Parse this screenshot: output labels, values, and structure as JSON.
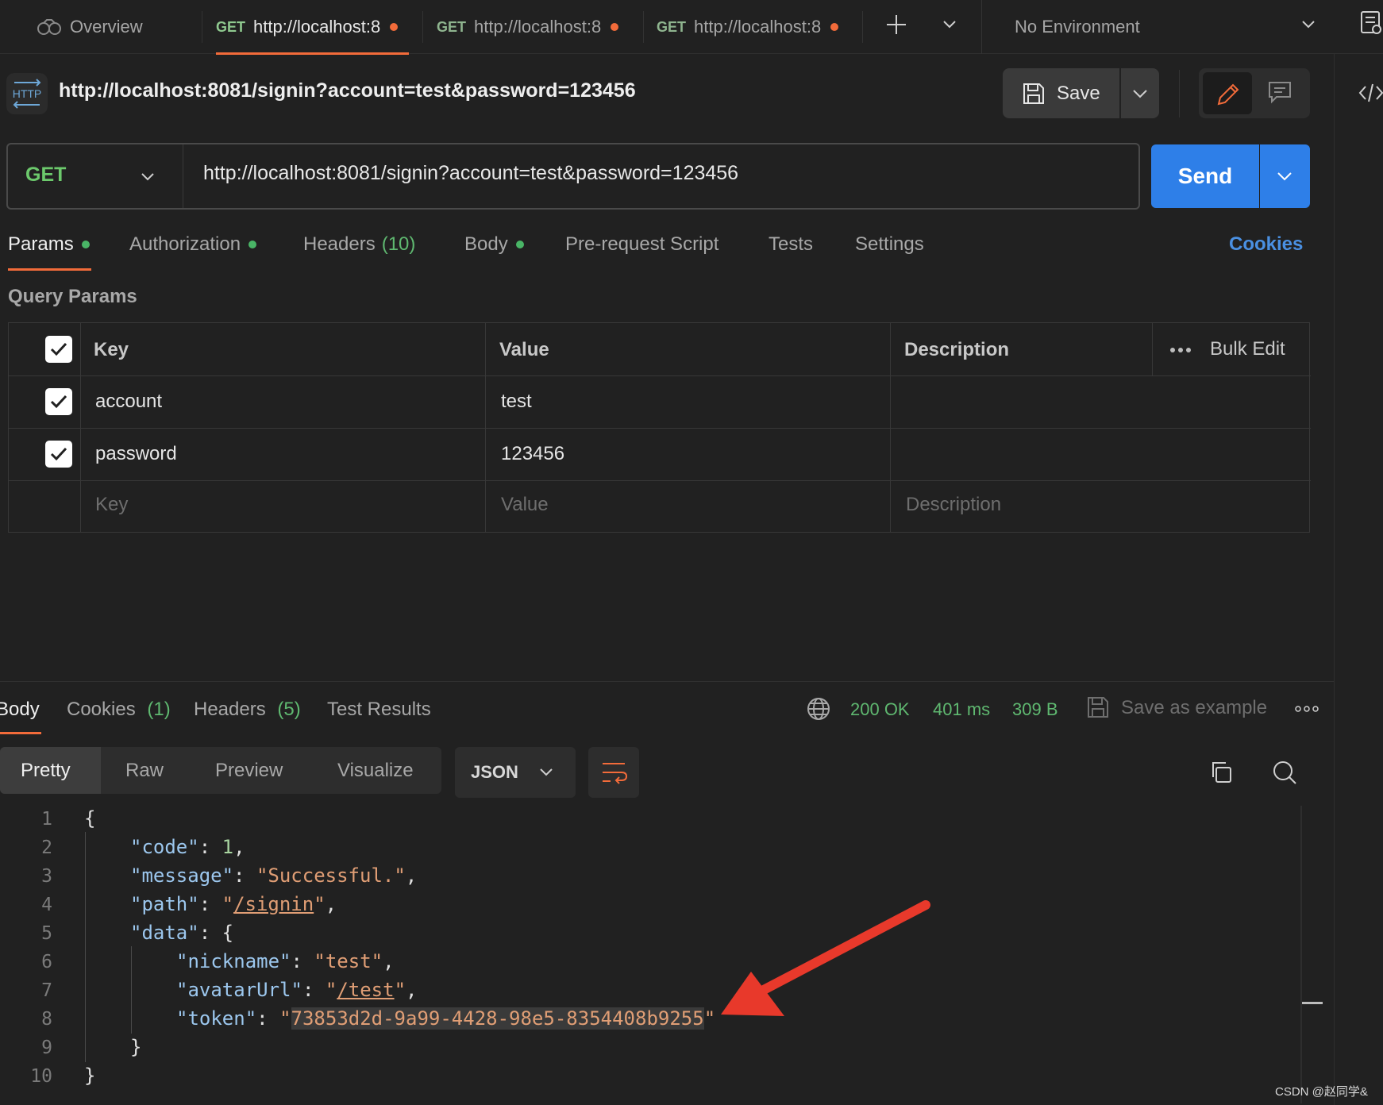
{
  "tabs": {
    "overview_label": "Overview",
    "items": [
      {
        "method": "GET",
        "label": "http://localhost:8"
      },
      {
        "method": "GET",
        "label": "http://localhost:8"
      },
      {
        "method": "GET",
        "label": "http://localhost:8"
      }
    ]
  },
  "environment": {
    "selected": "No Environment"
  },
  "request": {
    "badge": "HTTP",
    "title": "http://localhost:8081/signin?account=test&password=123456",
    "save_label": "Save",
    "method": "GET",
    "url": "http://localhost:8081/signin?account=test&password=123456",
    "send_label": "Send"
  },
  "request_tabs": {
    "params": "Params",
    "authorization": "Authorization",
    "headers": "Headers",
    "headers_count": "(10)",
    "body": "Body",
    "prerequest": "Pre-request Script",
    "tests": "Tests",
    "settings": "Settings",
    "cookies": "Cookies"
  },
  "query_params": {
    "title": "Query Params",
    "headers": {
      "key": "Key",
      "value": "Value",
      "description": "Description",
      "bulk_edit": "Bulk Edit"
    },
    "rows": [
      {
        "key": "account",
        "value": "test",
        "description": ""
      },
      {
        "key": "password",
        "value": "123456",
        "description": ""
      }
    ],
    "placeholder": {
      "key": "Key",
      "value": "Value",
      "description": "Description"
    }
  },
  "response": {
    "tabs": {
      "body": "Body",
      "cookies": "Cookies",
      "cookies_count": "(1)",
      "headers": "Headers",
      "headers_count": "(5)",
      "test_results": "Test Results"
    },
    "status": "200 OK",
    "time": "401 ms",
    "size": "309 B",
    "save_example": "Save as example",
    "views": {
      "pretty": "Pretty",
      "raw": "Raw",
      "preview": "Preview",
      "visualize": "Visualize"
    },
    "format": "JSON",
    "code": {
      "line_numbers": [
        "1",
        "2",
        "3",
        "4",
        "5",
        "6",
        "7",
        "8",
        "9",
        "10"
      ],
      "open_brace": "{",
      "code_key": "\"code\"",
      "code_val": "1",
      "message_key": "\"message\"",
      "message_val": "\"Successful.\"",
      "path_key": "\"path\"",
      "path_val": "/signin",
      "data_key": "\"data\"",
      "nickname_key": "\"nickname\"",
      "nickname_val": "\"test\"",
      "avatar_key": "\"avatarUrl\"",
      "avatar_val": "/test",
      "token_key": "\"token\"",
      "token_val": "73853d2d-9a99-4428-98e5-8354408b9255",
      "close_inner": "}",
      "close_outer": "}"
    }
  },
  "watermark": "CSDN @赵同学&",
  "colors": {
    "accent": "#f26b3a",
    "send": "#2e7fe8",
    "success": "#5fb870",
    "link": "#4a90e2",
    "arrow": "#e8392b"
  }
}
